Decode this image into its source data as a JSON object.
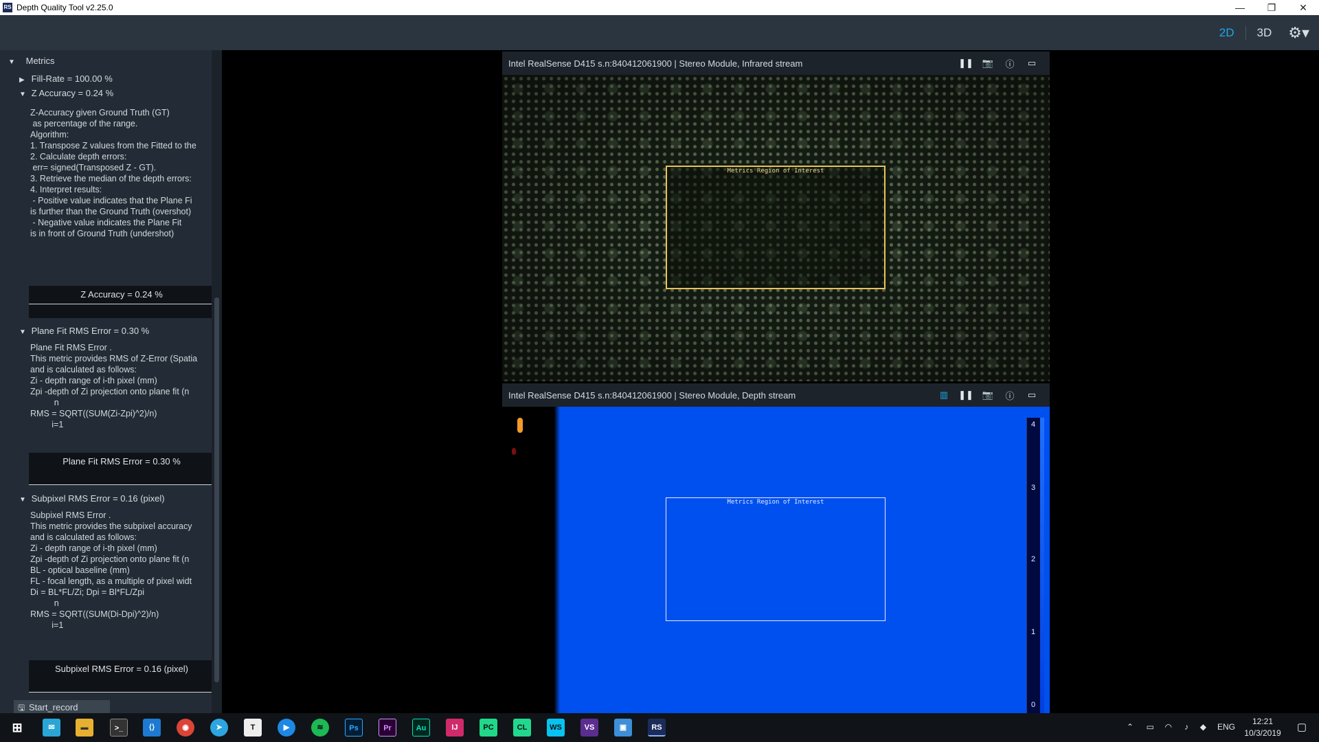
{
  "window": {
    "title": "Depth Quality Tool v2.25.0",
    "minimize": "—",
    "restore": "❐",
    "close": "✕"
  },
  "toolbar": {
    "mode_2d": "2D",
    "mode_3d": "3D",
    "settings_icon": "⚙▾"
  },
  "metrics": {
    "header": "Metrics",
    "fill_rate": {
      "label": "Fill-Rate = 100.00 %"
    },
    "z_accuracy": {
      "label": "Z Accuracy = 0.24 %",
      "description": "Z-Accuracy given Ground Truth (GT)\n as percentage of the range.\nAlgorithm:\n1. Transpose Z values from the Fitted to the\n2. Calculate depth errors:\n err= signed(Transposed Z - GT).\n3. Retrieve the median of the depth errors:\n4. Interpret results:\n - Positive value indicates that the Plane Fi\nis further than the Ground Truth (overshot)\n - Negative value indicates the Plane Fit\nis in front of Ground Truth (undershot)",
      "value": "Z Accuracy = 0.24 %"
    },
    "plane_fit": {
      "label": "Plane Fit RMS Error = 0.30 %",
      "description": "Plane Fit RMS Error .\nThis metric provides RMS of Z-Error (Spatia\nand is calculated as follows:\nZi - depth range of i-th pixel (mm)\nZpi -depth of Zi projection onto plane fit (n\n          n\nRMS = SQRT((SUM(Zi-Zpi)^2)/n)\n         i=1",
      "value": "Plane Fit RMS Error = 0.30 %"
    },
    "subpixel": {
      "label": "Subpixel RMS Error = 0.16 (pixel)",
      "description": "Subpixel RMS Error .\nThis metric provides the subpixel accuracy\nand is calculated as follows:\nZi - depth range of i-th pixel (mm)\nZpi -depth of Zi projection onto plane fit (n\nBL - optical baseline (mm)\nFL - focal length, as a multiple of pixel widt\nDi = BL*FL/Zi; Dpi = Bl*FL/Zpi\n          n\nRMS = SQRT((SUM(Di-Dpi)^2)/n)\n         i=1",
      "value": "Subpixel RMS Error = 0.16 (pixel)"
    },
    "start_record": "Start_record"
  },
  "streams": {
    "infrared": {
      "title": "Intel RealSense D415 s.n:840412061900 | Stereo Module, Infrared stream",
      "roi_label": "Metrics Region of Interest"
    },
    "depth": {
      "title": "Intel RealSense D415 s.n:840412061900 | Stereo Module, Depth stream",
      "roi_label": "Metrics Region of Interest",
      "colorbar_ticks": [
        "4",
        "3",
        "2",
        "1",
        "0"
      ]
    }
  },
  "taskbar": {
    "apps": [
      "Start",
      "Mail",
      "Explorer",
      "Terminal",
      "VS Code",
      "Chrome",
      "Telegram",
      "Typora",
      "Media",
      "Spotify",
      "Ps",
      "Pr",
      "Au",
      "IntelliJ",
      "PyCharm",
      "CLion",
      "WebStorm",
      "VS",
      "App",
      "RS"
    ],
    "tray": {
      "language": "ENG",
      "time": "12:21",
      "date": "10/3/2019"
    }
  }
}
